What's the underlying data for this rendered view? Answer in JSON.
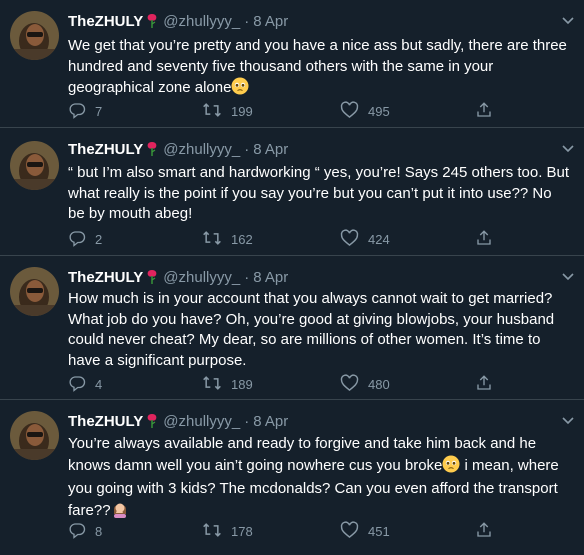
{
  "tweets": [
    {
      "name": "TheZHULY",
      "handle": "@zhullyyy_",
      "separator": "·",
      "date": "8 Apr",
      "text": "We get that you’re pretty and you have a nice ass but sadly, there are three hundred and seventy five thousand others with the same in your geographical zone alone",
      "trailing_emoji": "pleading-face",
      "replies": "7",
      "retweets": "199",
      "likes": "495"
    },
    {
      "name": "TheZHULY",
      "handle": "@zhullyyy_",
      "separator": "·",
      "date": "8 Apr",
      "text": "“ but I’m also smart and hardworking “  yes, you’re! Says 245 others too. But what really is the point if you say you’re but you can’t put it into use?? No be by mouth abeg!",
      "replies": "2",
      "retweets": "162",
      "likes": "424"
    },
    {
      "name": "TheZHULY",
      "handle": "@zhullyyy_",
      "separator": "·",
      "date": "8 Apr",
      "text": "How much is in your account that you always cannot wait to get married? What job do you have? Oh, you’re good at giving blowjobs, your husband could never cheat? My dear, so are millions of other women. It’s time to have a significant purpose.",
      "replies": "4",
      "retweets": "189",
      "likes": "480"
    },
    {
      "name": "TheZHULY",
      "handle": "@zhullyyy_",
      "separator": "·",
      "date": "8 Apr",
      "text_before_emoji": "You’re always available and ready to forgive and take him back and he knows damn well you ain’t going nowhere cus you broke",
      "inline_emoji": "pleading-face",
      "text_after_emoji": " i mean, where you going with 3 kids? The mcdonalds? Can you even afford the transport fare??",
      "trailing_emoji": "woman-facepalming",
      "replies": "8",
      "retweets": "178",
      "likes": "451"
    }
  ],
  "icons": {
    "reply": "reply-icon",
    "retweet": "retweet-icon",
    "like": "like-icon",
    "share": "share-icon",
    "rose": "rose-icon",
    "more": "chevron-down-icon"
  },
  "colors": {
    "background": "#15202b",
    "secondary_text": "#8899a6",
    "divider": "#38444d",
    "rose": "#e0245e"
  }
}
